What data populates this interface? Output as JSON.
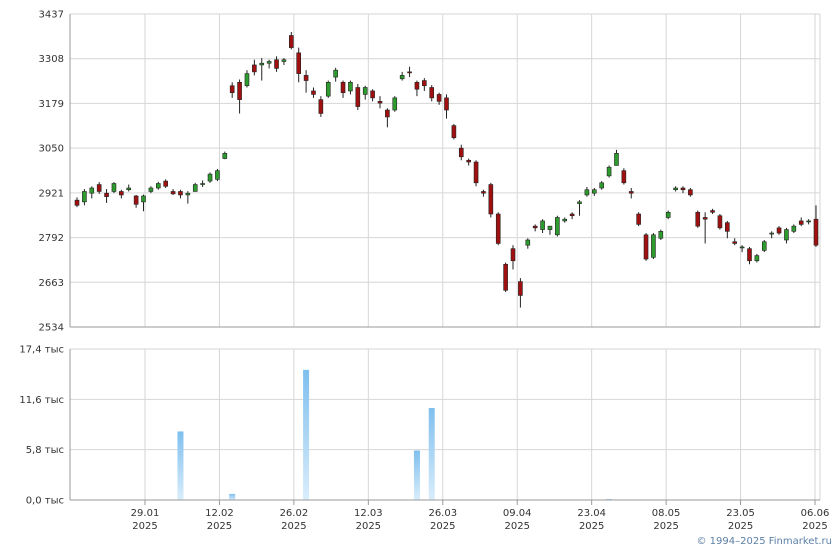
{
  "copyright": "© 1994–2025 Finmarket.ru",
  "colors": {
    "up": "#2e9b2e",
    "down": "#a01010",
    "volume": "#7fbfee",
    "grid": "#d6d6d6",
    "axis": "#999999"
  },
  "chart_data": [
    {
      "type": "candlestick",
      "ylim": [
        2534,
        3437
      ],
      "yticks": [
        "3437",
        "3308",
        "3179",
        "3050",
        "2921",
        "2792",
        "2663",
        "2534"
      ],
      "candles": [
        [
          2900,
          2885,
          2908,
          2880
        ],
        [
          2895,
          2925,
          2932,
          2885
        ],
        [
          2920,
          2935,
          2940,
          2905
        ],
        [
          2945,
          2925,
          2952,
          2918
        ],
        [
          2920,
          2910,
          2932,
          2892
        ],
        [
          2925,
          2948,
          2952,
          2920
        ],
        [
          2925,
          2915,
          2930,
          2905
        ],
        [
          2930,
          2935,
          2945,
          2925
        ],
        [
          2912,
          2888,
          2915,
          2878
        ],
        [
          2895,
          2912,
          2916,
          2868
        ],
        [
          2925,
          2935,
          2940,
          2920
        ],
        [
          2935,
          2948,
          2953,
          2930
        ],
        [
          2955,
          2940,
          2960,
          2935
        ],
        [
          2925,
          2918,
          2932,
          2915
        ],
        [
          2925,
          2915,
          2930,
          2905
        ],
        [
          2915,
          2920,
          2926,
          2890
        ],
        [
          2925,
          2945,
          2950,
          2940
        ],
        [
          2945,
          2948,
          2957,
          2938
        ],
        [
          2955,
          2975,
          2980,
          2950
        ],
        [
          2960,
          2985,
          2990,
          2955
        ],
        [
          3020,
          3035,
          3040,
          3018
        ],
        [
          3230,
          3210,
          3240,
          3195
        ],
        [
          3240,
          3190,
          3248,
          3150
        ],
        [
          3230,
          3265,
          3275,
          3225
        ],
        [
          3290,
          3270,
          3305,
          3260
        ],
        [
          3290,
          3295,
          3310,
          3245
        ],
        [
          3295,
          3300,
          3305,
          3280
        ],
        [
          3305,
          3280,
          3315,
          3270
        ],
        [
          3300,
          3305,
          3310,
          3290
        ],
        [
          3375,
          3340,
          3385,
          3335
        ],
        [
          3325,
          3265,
          3340,
          3240
        ],
        [
          3260,
          3245,
          3275,
          3210
        ],
        [
          3215,
          3205,
          3225,
          3195
        ],
        [
          3190,
          3150,
          3200,
          3140
        ],
        [
          3200,
          3240,
          3245,
          3195
        ],
        [
          3255,
          3275,
          3282,
          3242
        ],
        [
          3240,
          3210,
          3245,
          3195
        ],
        [
          3215,
          3240,
          3245,
          3205
        ],
        [
          3225,
          3170,
          3235,
          3160
        ],
        [
          3205,
          3225,
          3230,
          3190
        ],
        [
          3215,
          3195,
          3220,
          3185
        ],
        [
          3185,
          3180,
          3200,
          3165
        ],
        [
          3160,
          3140,
          3165,
          3110
        ],
        [
          3160,
          3195,
          3200,
          3155
        ],
        [
          3250,
          3260,
          3270,
          3245
        ],
        [
          3270,
          3268,
          3285,
          3255
        ],
        [
          3240,
          3220,
          3245,
          3200
        ],
        [
          3245,
          3230,
          3252,
          3215
        ],
        [
          3225,
          3195,
          3232,
          3185
        ],
        [
          3205,
          3185,
          3210,
          3175
        ],
        [
          3195,
          3160,
          3205,
          3135
        ],
        [
          3115,
          3080,
          3120,
          3075
        ],
        [
          3050,
          3025,
          3060,
          3015
        ],
        [
          3015,
          3010,
          3020,
          3000
        ],
        [
          3010,
          2950,
          3015,
          2940
        ],
        [
          2925,
          2920,
          2930,
          2910
        ],
        [
          2945,
          2860,
          2950,
          2850
        ],
        [
          2860,
          2775,
          2865,
          2770
        ],
        [
          2715,
          2640,
          2720,
          2635
        ],
        [
          2760,
          2725,
          2770,
          2700
        ],
        [
          2665,
          2625,
          2675,
          2590
        ],
        [
          2770,
          2785,
          2790,
          2760
        ],
        [
          2825,
          2820,
          2830,
          2810
        ],
        [
          2815,
          2840,
          2845,
          2805
        ],
        [
          2815,
          2825,
          2825,
          2800
        ],
        [
          2800,
          2850,
          2855,
          2795
        ],
        [
          2840,
          2845,
          2850,
          2835
        ],
        [
          2860,
          2855,
          2865,
          2845
        ],
        [
          2890,
          2895,
          2900,
          2855
        ],
        [
          2915,
          2930,
          2938,
          2910
        ],
        [
          2920,
          2930,
          2935,
          2912
        ],
        [
          2935,
          2950,
          2955,
          2930
        ],
        [
          2970,
          2995,
          3000,
          2965
        ],
        [
          3000,
          3035,
          3045,
          3000
        ],
        [
          2985,
          2950,
          2992,
          2945
        ],
        [
          2925,
          2920,
          2935,
          2905
        ],
        [
          2860,
          2830,
          2865,
          2825
        ],
        [
          2800,
          2730,
          2805,
          2725
        ],
        [
          2735,
          2800,
          2805,
          2730
        ],
        [
          2790,
          2810,
          2815,
          2785
        ],
        [
          2850,
          2865,
          2870,
          2845
        ],
        [
          2930,
          2935,
          2940,
          2925
        ],
        [
          2935,
          2930,
          2940,
          2920
        ],
        [
          2930,
          2915,
          2935,
          2910
        ],
        [
          2865,
          2825,
          2870,
          2820
        ],
        [
          2850,
          2845,
          2865,
          2775
        ],
        [
          2870,
          2865,
          2875,
          2860
        ],
        [
          2855,
          2820,
          2860,
          2815
        ],
        [
          2835,
          2810,
          2840,
          2790
        ],
        [
          2780,
          2775,
          2790,
          2770
        ],
        [
          2765,
          2765,
          2770,
          2750
        ],
        [
          2760,
          2725,
          2765,
          2715
        ],
        [
          2725,
          2740,
          2745,
          2720
        ],
        [
          2755,
          2780,
          2785,
          2750
        ],
        [
          2805,
          2805,
          2810,
          2790
        ],
        [
          2820,
          2805,
          2825,
          2800
        ],
        [
          2785,
          2815,
          2820,
          2775
        ],
        [
          2810,
          2825,
          2830,
          2805
        ],
        [
          2840,
          2830,
          2850,
          2825
        ],
        [
          2840,
          2840,
          2845,
          2830
        ],
        [
          2845,
          2770,
          2885,
          2765
        ]
      ]
    },
    {
      "type": "bar",
      "ylim": [
        0,
        17.4
      ],
      "yticks": [
        "17,4 тыс",
        "11,6 тыс",
        "5,8 тыс",
        "0,0 тыс"
      ],
      "volumes": [
        {
          "i": 14,
          "v": 7.9
        },
        {
          "i": 20,
          "v": 0.05
        },
        {
          "i": 21,
          "v": 0.7
        },
        {
          "i": 31,
          "v": 15.0
        },
        {
          "i": 46,
          "v": 5.7
        },
        {
          "i": 48,
          "v": 10.6
        },
        {
          "i": 72,
          "v": 0.1
        }
      ],
      "xticks": [
        {
          "i": 9,
          "date": "29.01",
          "year": "2025"
        },
        {
          "i": 19,
          "date": "12.02",
          "year": "2025"
        },
        {
          "i": 29,
          "date": "26.02",
          "year": "2025"
        },
        {
          "i": 39,
          "date": "12.03",
          "year": "2025"
        },
        {
          "i": 49,
          "date": "26.03",
          "year": "2025"
        },
        {
          "i": 59,
          "date": "09.04",
          "year": "2025"
        },
        {
          "i": 69,
          "date": "23.04",
          "year": "2025"
        },
        {
          "i": 79,
          "date": "08.05",
          "year": "2025"
        },
        {
          "i": 89,
          "date": "23.05",
          "year": "2025"
        },
        {
          "i": 99,
          "date": "06.06",
          "year": "2025"
        }
      ]
    }
  ]
}
